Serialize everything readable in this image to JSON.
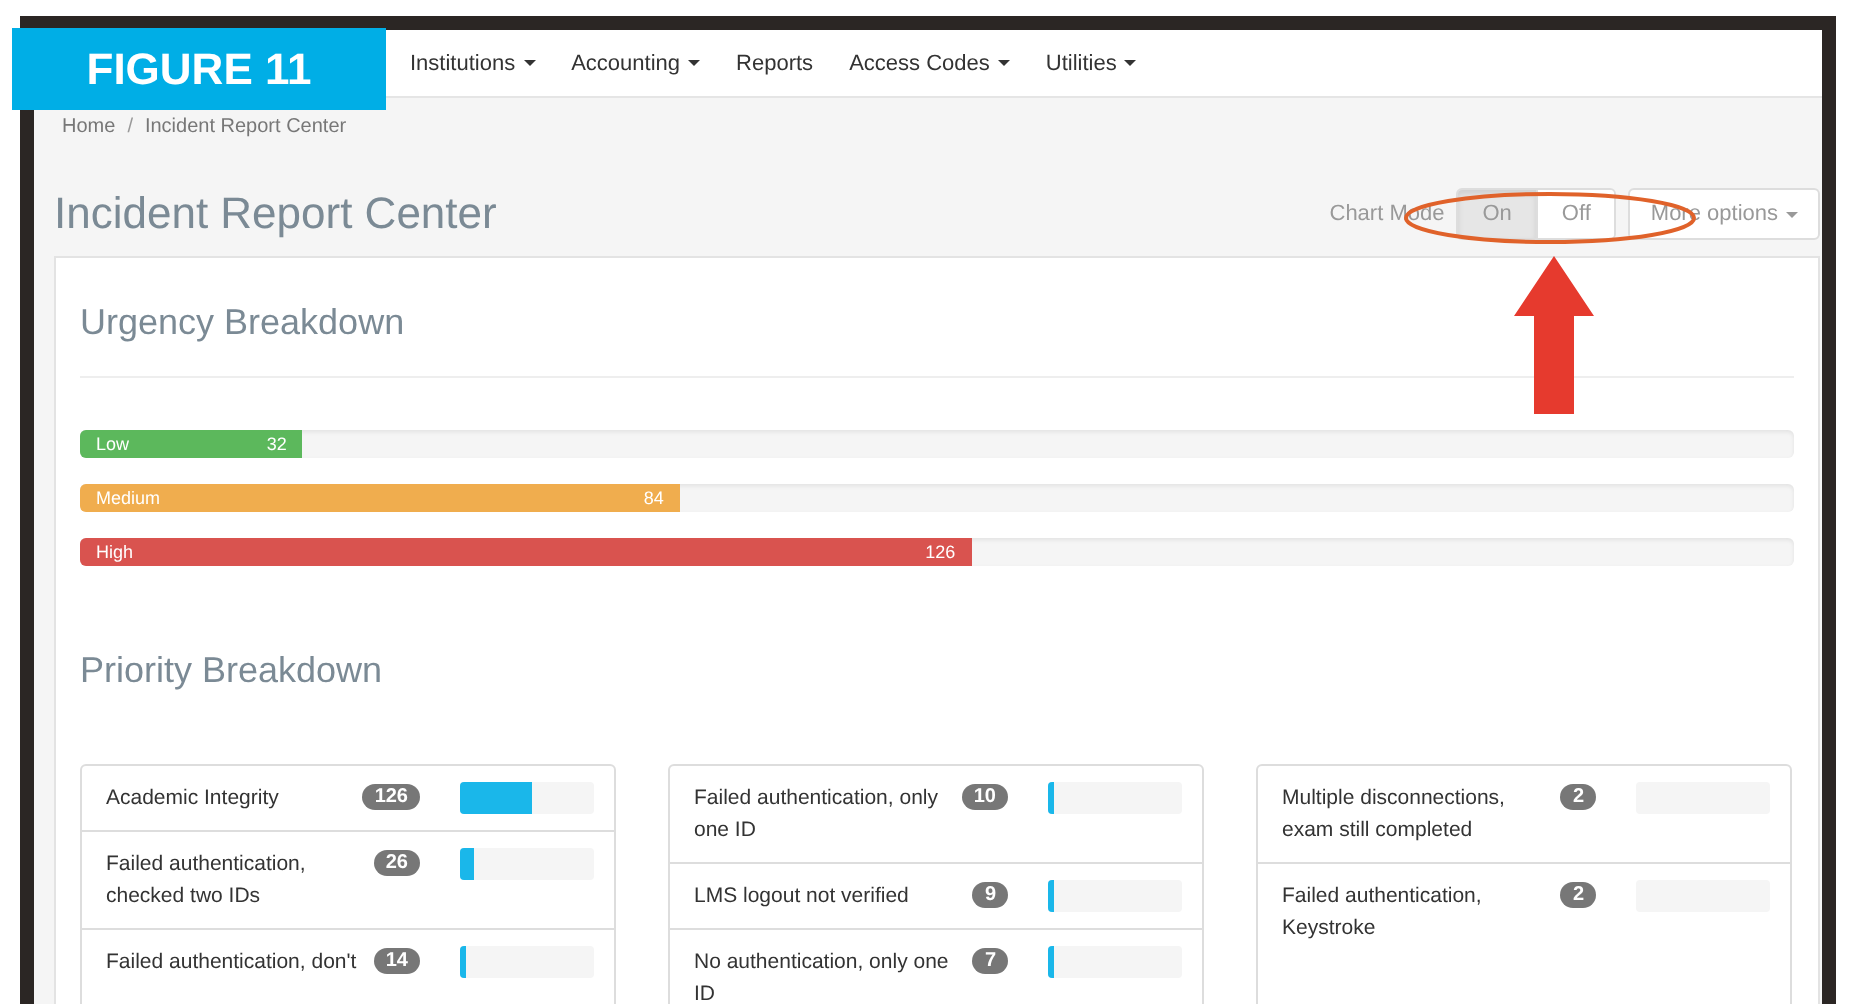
{
  "figure_label": "FIGURE 11",
  "nav": [
    {
      "label": "Institutions",
      "dropdown": true
    },
    {
      "label": "Accounting",
      "dropdown": true
    },
    {
      "label": "Reports",
      "dropdown": false
    },
    {
      "label": "Access Codes",
      "dropdown": true
    },
    {
      "label": "Utilities",
      "dropdown": true
    }
  ],
  "breadcrumb": [
    "Home",
    "Incident Report Center"
  ],
  "breadcrumb_separator": "/",
  "title": "Incident Report Center",
  "chart_mode": {
    "label": "Chart Mode",
    "options": [
      {
        "label": "On",
        "selected": true
      },
      {
        "label": "Off",
        "selected": false
      }
    ]
  },
  "more_options": "More options",
  "urgency": {
    "title": "Urgency Breakdown",
    "bars": [
      {
        "label": "Low",
        "count": "32",
        "level": 0.13,
        "color": "#5cb85c"
      },
      {
        "label": "Medium",
        "count": "84",
        "level": 0.35,
        "color": "#f0ad4e"
      },
      {
        "label": "High",
        "count": "126",
        "level": 0.52,
        "color": "#d9534f"
      }
    ]
  },
  "priority": {
    "title": "Priority Breakdown",
    "columns": [
      [
        {
          "label": "Academic Integrity",
          "count": "126",
          "level": 0.54
        },
        {
          "label": "Failed authentication, checked two IDs",
          "count": "26",
          "level": 0.1
        },
        {
          "label": "Failed authentication, don't",
          "count": "14",
          "level": 0.05
        }
      ],
      [
        {
          "label": "Failed authentication, only one ID",
          "count": "10",
          "level": 0.03
        },
        {
          "label": "LMS logout not verified",
          "count": "9",
          "level": 0.03
        },
        {
          "label": "No authentication, only one ID",
          "count": "7",
          "level": 0.03
        }
      ],
      [
        {
          "label": "Multiple disconnections, exam still completed",
          "count": "2",
          "level": 0
        },
        {
          "label": "Failed authentication, Keystroke",
          "count": "2",
          "level": 0
        }
      ]
    ]
  }
}
